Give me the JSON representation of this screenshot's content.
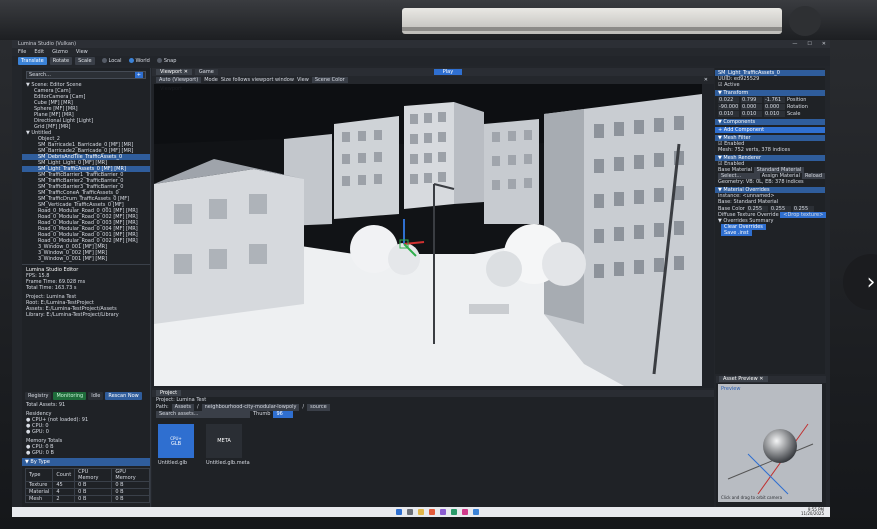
{
  "window": {
    "title": "Lumina Studio (Vulkan)",
    "controls": [
      "—",
      "☐",
      "✕"
    ]
  },
  "menu": [
    "File",
    "Edit",
    "Gizmo",
    "View"
  ],
  "toolbar": {
    "translate": "Translate",
    "rotate": "Rotate",
    "scale": "Scale",
    "local": "Local",
    "world": "World",
    "snap": "Snap"
  },
  "hierarchy": {
    "search_placeholder": "Search...",
    "add_label": "+",
    "items": [
      "▼ Scene: Editor Scene",
      "Camera  [Cam]",
      "EditorCamera  [Cam]",
      "Cube  [MF] [MR]",
      "Sphere  [MF] [MR]",
      "Plane  [MF] [MR]",
      "Directional Light  [Light]",
      "Grid  [MF] [MR]",
      "▼ Untitled",
      "Object_2",
      "SM_Barricade1_Barricade_0  [MF] [MR]",
      "SM_Barricade2_Barricade_0  [MF] [MR]",
      "SM_DebrisAndTile_TrafficAssets_0",
      "SM_Light_Light_0  [MF] [MR]",
      "SM_Light_TrafficAssets_0  [MF] [MR]",
      "SM_TrafficBarrier1_TrafficBarrier_0",
      "SM_TrafficBarrier2_TrafficBarrier_0",
      "SM_TrafficBarrier3_TrafficBarrier_0",
      "SM_TrafficConeA_TrafficAssets_0",
      "SM_TrafficDrum_TrafficAssets_0  [MF]",
      "SM_Verticade_TrafficAssets_0  [MF]",
      "Road_0_Modular_Road_0_001  [MF] [MR]",
      "Road_0_Modular_Road_0_002  [MF] [MR]",
      "Road_0_Modular_Road_0_003  [MF] [MR]",
      "Road_0_Modular_Road_0_004  [MF] [MR]",
      "Road_0_Modular_Road_0_001  [MF] [MR]",
      "Road_0_Modular_Road_0_002  [MF] [MR]",
      "3_Window_0_001  [MF] [MR]",
      "3_Window_0_002  [MF] [MR]",
      "3_Window_0_001  [MF] [MR]"
    ],
    "selected_index": 14
  },
  "editor_info": {
    "title": "Lumina Studio Editor",
    "fps": "FPS: 15.8",
    "frame_time": "Frame Time: 69.028 ms",
    "total_time": "Total Time: 163.73 s",
    "project": "Project: Lumina Test",
    "root": "Root: E:/Lumina-TestProject",
    "assets": "Assets: E:/Lumina-TestProject/Assets",
    "library": "Library: E:/Lumina-TestProject/Library"
  },
  "registry": {
    "tabs": [
      "Registry",
      "Monitoring",
      "Idle",
      "Rescan Now"
    ],
    "total_assets": "Total Assets: 91",
    "residency_title": "Residency",
    "residency": [
      "● CPU+ (not loaded): 91",
      "● CPU: 0",
      "● GPU: 0"
    ],
    "memory_title": "Memory Totals",
    "memory": [
      "● CPU: 0 B",
      "● GPU: 0 B"
    ],
    "by_type_title": "▼ By Type",
    "table_headers": [
      "Type",
      "Count",
      "CPU Memory",
      "GPU Memory"
    ],
    "table_rows": [
      [
        "Texture",
        "45",
        "0 B",
        "0 B"
      ],
      [
        "Material",
        "4",
        "0 B",
        "0 B"
      ],
      [
        "Mesh",
        "2",
        "0 B",
        "0 B"
      ]
    ]
  },
  "viewport": {
    "tabs": [
      "Viewport ✕",
      "Game"
    ],
    "play_label": "Play",
    "view_dropdown": "Auto (Viewport)",
    "mode_label": "Mode",
    "size_label": "Size follows viewport window",
    "view_label": "View",
    "scene_color": "Scene Color",
    "label": "Viewport",
    "close": "✕"
  },
  "inspector": {
    "object_name": "SM_Light_TrafficAssets_0",
    "uuid": "UUID: ed925529",
    "active_label": "Active",
    "transform_title": "▼ Transform",
    "transform_rows": [
      {
        "vals": [
          "0.022",
          "0.799",
          "-1.761"
        ],
        "label": "Position"
      },
      {
        "vals": [
          "-90.000",
          "0.000",
          "0.000"
        ],
        "label": "Rotation"
      },
      {
        "vals": [
          "0.010",
          "0.010",
          "0.010"
        ],
        "label": "Scale"
      }
    ],
    "components_title": "▼ Components",
    "add_component": "+ Add Component",
    "mesh_filter_title": "▼ Mesh Filter",
    "enabled": "Enabled",
    "mesh_info": "Mesh: 752 verts, 378 indices",
    "mesh_renderer_title": "▼ Mesh Renderer",
    "renderer_enabled": "Enabled",
    "base_material_label": "Base Material",
    "base_material_value": "Standard Material",
    "select_label": "Select...",
    "assign_material": "Assign Material",
    "reload": "Reload",
    "geometry_info": "Geometry: VB: 0L, EB: 378 indices",
    "material_overrides_title": "▼ Material Overrides",
    "instance_name": "instance: <unnamed>",
    "base_info": "Base: Standard Material",
    "base_color_label": "Base Color",
    "base_color_vals": [
      "0.255",
      "0.255",
      "0.255"
    ],
    "diffuse_override": "Diffuse Texture Override",
    "diffuse_value": "<Drop texture>",
    "overrides_summary": "▼ Overrides Summary",
    "clear_overrides": "Clear Overrides",
    "save_inst": "Save .inst"
  },
  "project_panel": {
    "tab": "Project",
    "project_name": "Project: Lumina Test",
    "path_label": "Path:",
    "path_chips": [
      "Assets",
      "neighbourhood-city-modular-lowpoly",
      "source"
    ],
    "search_placeholder": "Search assets...",
    "thumb_label": "Thumb",
    "thumb_value": "96",
    "assets": [
      {
        "thumb": "GLB",
        "badge": "CPU+",
        "name": "Untitled.glb"
      },
      {
        "thumb": "META",
        "badge": "",
        "name": "Untitled.glb.meta"
      }
    ]
  },
  "asset_preview": {
    "tab": "Asset Preview ✕",
    "label": "Preview",
    "hint": "Click and drag to orbit camera"
  },
  "taskbar": {
    "time": "9:55 PM",
    "date": "11/20/2025"
  },
  "nav": {
    "next": "›"
  }
}
